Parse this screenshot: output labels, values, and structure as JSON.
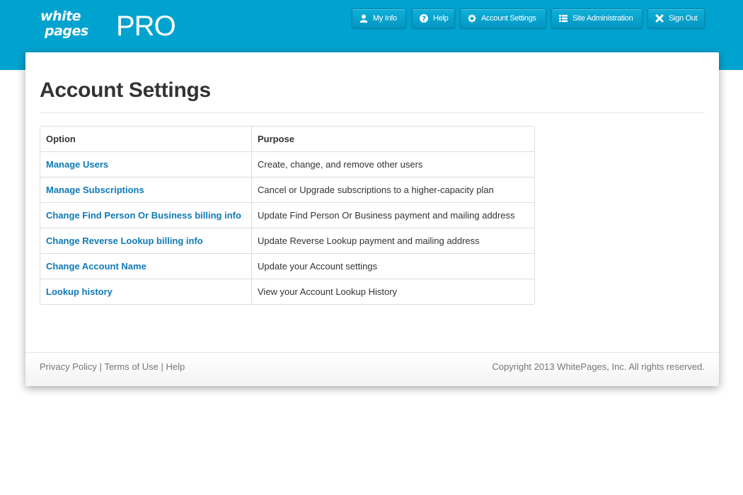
{
  "brand": {
    "word1": "white",
    "word2": "pages",
    "suffix": "PRO"
  },
  "nav": [
    {
      "label": "My Info",
      "icon": "user-icon"
    },
    {
      "label": "Help",
      "icon": "question-icon"
    },
    {
      "label": "Account Settings",
      "icon": "gear-icon"
    },
    {
      "label": "Site Administration",
      "icon": "list-icon"
    },
    {
      "label": "Sign Out",
      "icon": "close-icon"
    }
  ],
  "page": {
    "title": "Account Settings"
  },
  "table": {
    "headers": [
      "Option",
      "Purpose"
    ],
    "rows": [
      {
        "option": "Manage Users",
        "purpose": "Create, change, and remove other users"
      },
      {
        "option": "Manage Subscriptions",
        "purpose": "Cancel or Upgrade subscriptions to a higher-capacity plan"
      },
      {
        "option": "Change Find Person Or Business billing info",
        "purpose": "Update Find Person Or Business payment and mailing address"
      },
      {
        "option": "Change Reverse Lookup billing info",
        "purpose": "Update Reverse Lookup payment and mailing address"
      },
      {
        "option": "Change Account Name",
        "purpose": "Update your Account settings"
      },
      {
        "option": "Lookup history",
        "purpose": "View your Account Lookup History"
      }
    ]
  },
  "footer": {
    "links": [
      "Privacy Policy",
      "Terms of Use",
      "Help"
    ],
    "separator": "|",
    "copyright": "Copyright 2013 WhitePages, Inc. All rights reserved."
  },
  "colors": {
    "header_bg": "#00a3cf",
    "link": "#0e7ab8"
  }
}
